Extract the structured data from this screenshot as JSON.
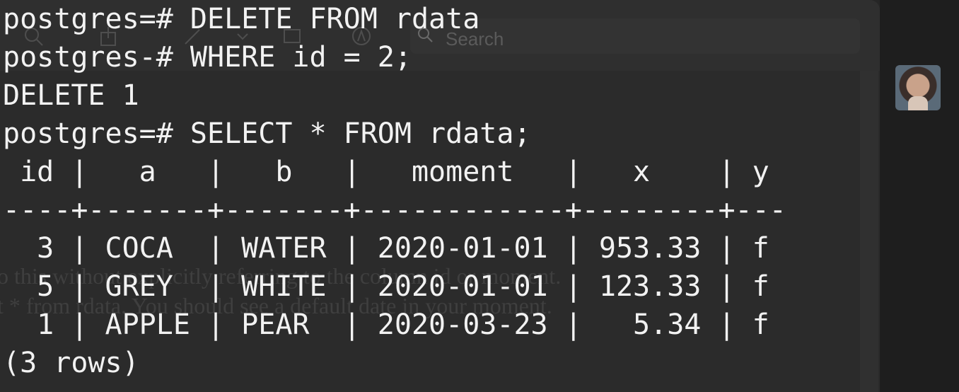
{
  "background_window": {
    "search_placeholder": "Search",
    "doc_lines": [
      "o this without explicitly referring to the column id or moment.",
      "t * from rdata. You should see a default date in your moment."
    ],
    "icons": [
      "zoom-icon",
      "share-icon",
      "pen-icon",
      "chevron-down-icon",
      "window-icon",
      "markup-icon",
      "search-icon"
    ]
  },
  "terminal": {
    "lines": [
      "postgres=# DELETE FROM rdata",
      "postgres-# WHERE id = 2;",
      "DELETE 1",
      "postgres=# SELECT * FROM rdata;"
    ],
    "table": {
      "header": " id |   a   |   b   |   moment   |   x    | y",
      "separator": "----+-------+-------+------------+--------+---",
      "rows": [
        "  3 | COCA  | WATER | 2020-01-01 | 953.33 | f",
        "  5 | GREY  | WHITE | 2020-01-01 | 123.33 | f",
        "  1 | APPLE | PEAR  | 2020-03-23 |   5.34 | f"
      ],
      "footer": "(3 rows)"
    }
  },
  "sidebar": {
    "avatar_label": "avatar"
  }
}
